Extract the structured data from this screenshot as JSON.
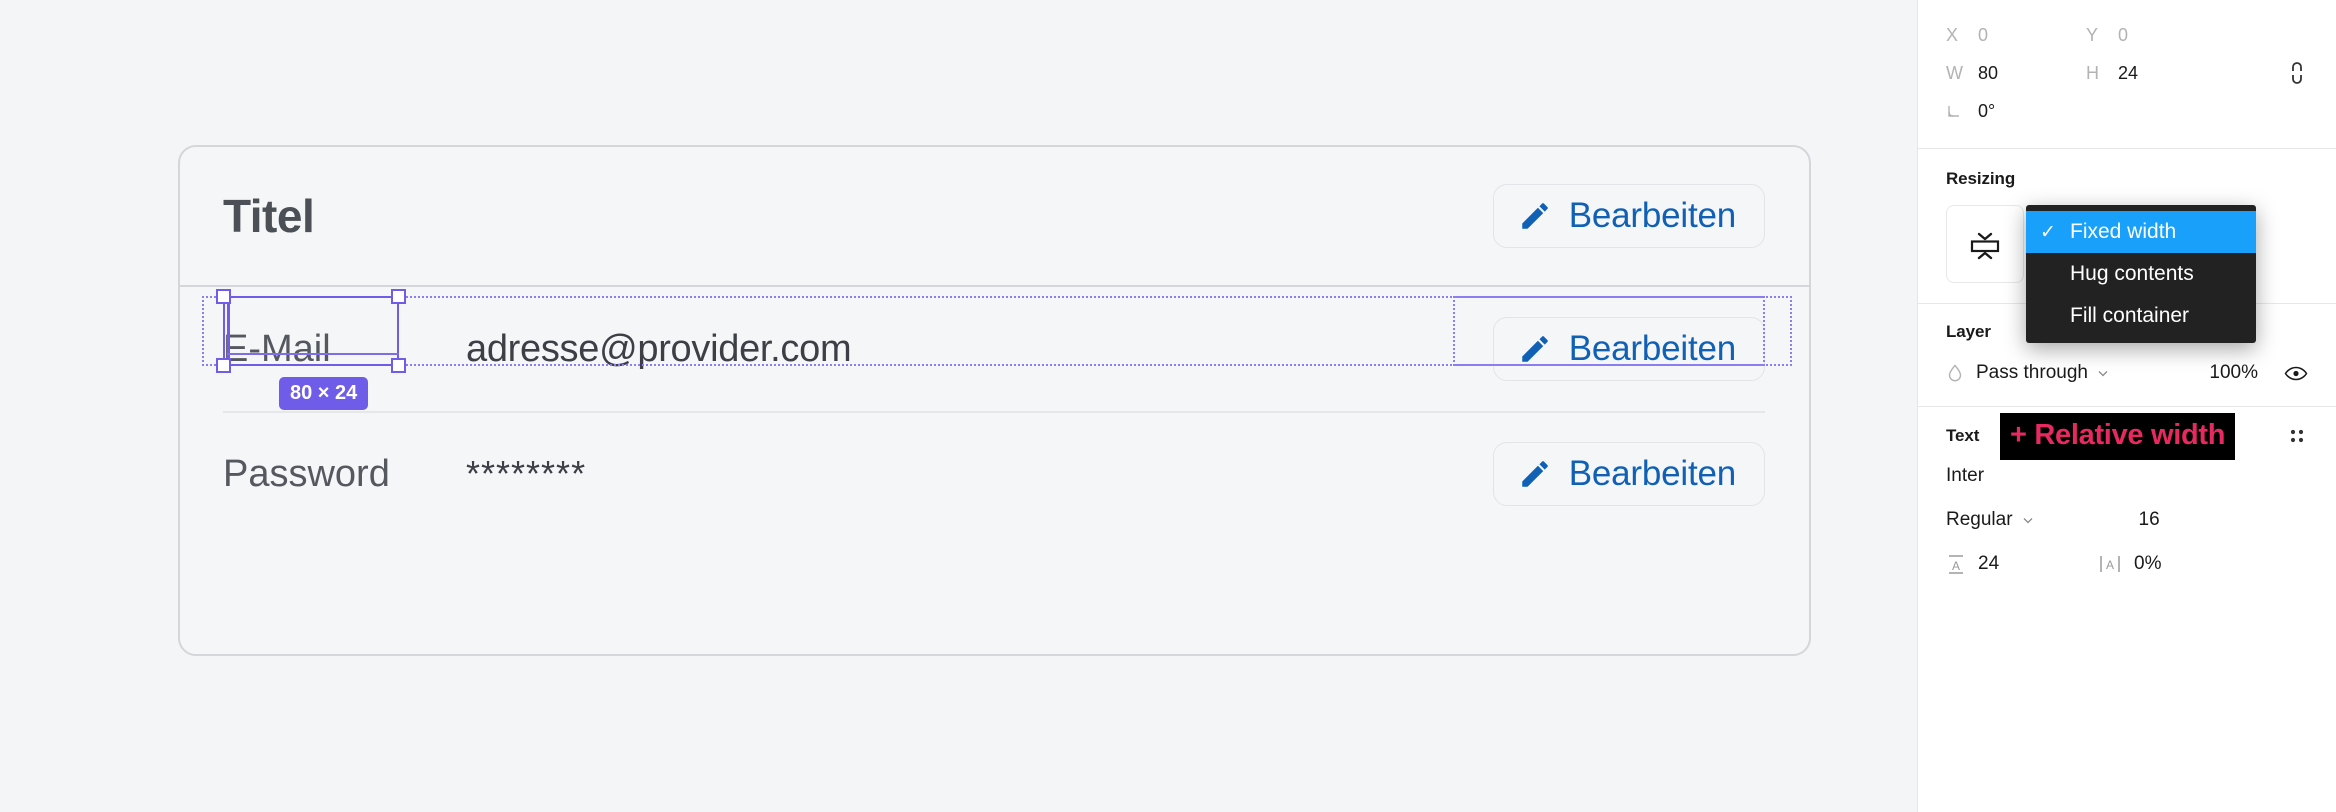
{
  "canvas": {
    "card": {
      "title": "Titel",
      "header_button": {
        "label": "Bearbeiten",
        "icon": "pencil-icon"
      },
      "rows": [
        {
          "label": "E-Mail",
          "value": "adresse@provider.com",
          "button": {
            "label": "Bearbeiten",
            "icon": "pencil-icon"
          },
          "selected": true
        },
        {
          "label": "Password",
          "value": "********",
          "button": {
            "label": "Bearbeiten",
            "icon": "pencil-icon"
          },
          "selected": false
        }
      ]
    },
    "selection": {
      "size_badge": "80 × 24",
      "selection_color": "#6f5ce8",
      "parent_outline_color": "#8b7ef0"
    }
  },
  "right_panel": {
    "geometry": {
      "x_key": "X",
      "x_value": "0",
      "y_key": "Y",
      "y_value": "0",
      "w_key": "W",
      "w_value": "80",
      "h_key": "H",
      "h_value": "24",
      "rotation_value": "0°",
      "link_icon": "unlink-aspect-ratio-icon",
      "angle_icon": "rotation-angle-icon"
    },
    "resizing": {
      "title": "Resizing",
      "control_icon": "vertical-resize-icon",
      "menu": {
        "items": [
          {
            "label": "Fixed width",
            "checked": true,
            "check": "✓"
          },
          {
            "label": "Hug contents",
            "checked": false,
            "check": ""
          },
          {
            "label": "Fill container",
            "checked": false,
            "check": ""
          }
        ],
        "highlight_color": "#18a0fb",
        "background_color": "#222222"
      },
      "annotation": {
        "text": "+ Relative width",
        "text_color": "#e8295f",
        "background_color": "#000000"
      }
    },
    "layer": {
      "title": "Layer",
      "blend_icon": "blend-mode-droplet-icon",
      "blend_mode": "Pass through",
      "opacity": "100%",
      "visibility_icon": "eye-icon",
      "chevron_icon": "chevron-down-icon"
    },
    "text": {
      "title": "Text",
      "more_icon": "more-options-grid-icon",
      "font_family": "Inter",
      "font_weight": "Regular",
      "font_size": "16",
      "line_height_icon": "line-height-icon",
      "line_height": "24",
      "letter_spacing_icon": "letter-spacing-icon",
      "letter_spacing": "0%",
      "chevron_icon": "chevron-down-icon"
    }
  }
}
